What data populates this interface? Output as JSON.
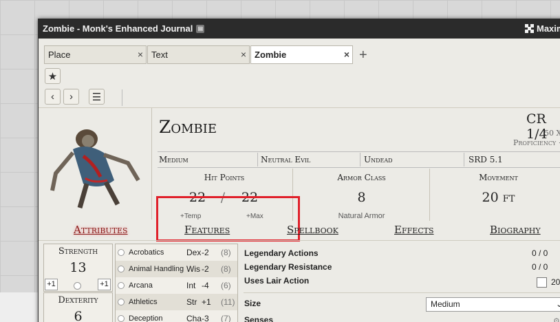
{
  "window": {
    "title": "Zombie - Monk's Enhanced Journal",
    "maximize_label": "Maxim"
  },
  "tabs": [
    {
      "label": "Place",
      "active": false
    },
    {
      "label": "Text",
      "active": false
    },
    {
      "label": "Zombie",
      "active": true
    }
  ],
  "add_tab_icon": "+",
  "close_icon": "×",
  "toolbar": {
    "icons": [
      "star-icon",
      "chevron-left-icon",
      "chevron-right-icon",
      "list-icon"
    ]
  },
  "creature": {
    "name": "Zombie",
    "cr": "CR 1/4",
    "xp": "50 X",
    "proficiency": "Proficiency +",
    "size": "Medium",
    "alignment": "Neutral Evil",
    "type": "Undead",
    "source": "SRD 5.1"
  },
  "stats": {
    "hp_label": "Hit Points",
    "hp_current": "22",
    "hp_sep": "/",
    "hp_max": "22",
    "hp_temp_label": "+Temp",
    "hp_max_label": "+Max",
    "ac_label": "Armor Class",
    "ac_value": "8",
    "ac_note": "Natural Armor",
    "move_label": "Movement",
    "move_value": "20 ft"
  },
  "sheet_tabs": [
    {
      "label": "Attributes",
      "active": true
    },
    {
      "label": "Features",
      "active": false
    },
    {
      "label": "Spellbook",
      "active": false
    },
    {
      "label": "Effects",
      "active": false
    },
    {
      "label": "Biography",
      "active": false
    }
  ],
  "abilities": [
    {
      "name": "Strength",
      "score": "13",
      "mod": "+1",
      "save": "+1"
    },
    {
      "name": "Dexterity",
      "score": "6"
    }
  ],
  "skills": [
    {
      "name": "Acrobatics",
      "ability": "Dex",
      "mod": "-2",
      "passive": "(8)"
    },
    {
      "name": "Animal Handling",
      "ability": "Wis",
      "mod": "-2",
      "passive": "(8)"
    },
    {
      "name": "Arcana",
      "ability": "Int",
      "mod": "-4",
      "passive": "(6)"
    },
    {
      "name": "Athletics",
      "ability": "Str",
      "mod": "+1",
      "passive": "(11)"
    },
    {
      "name": "Deception",
      "ability": "Cha",
      "mod": "-3",
      "passive": "(7)"
    }
  ],
  "resources": {
    "legendary_actions_label": "Legendary Actions",
    "legendary_actions_value": "0 / 0",
    "legendary_resistance_label": "Legendary Resistance",
    "legendary_resistance_value": "0 / 0",
    "lair_label": "Uses Lair Action",
    "lair_value": "20",
    "size_label": "Size",
    "size_value": "Medium",
    "senses_label": "Senses"
  },
  "colors": {
    "titlebar": "#2b2b2b",
    "parchment": "#ecebe6",
    "highlight_box": "#e0202a",
    "active_tab_text": "#8b1a1a"
  }
}
